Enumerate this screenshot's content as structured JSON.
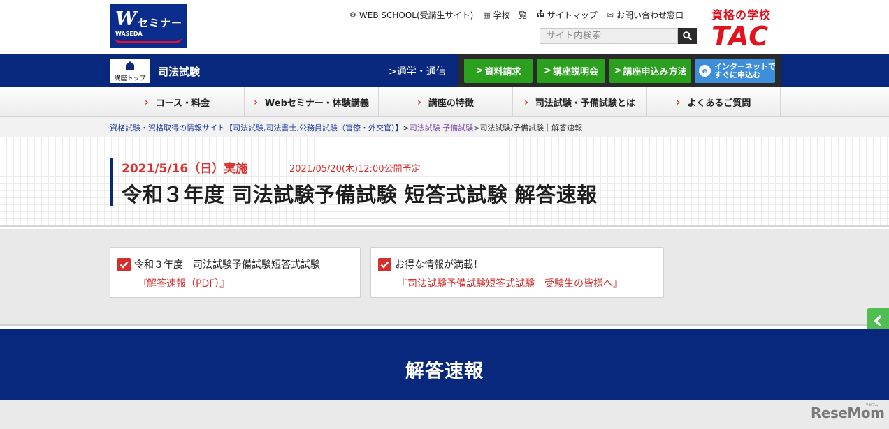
{
  "header": {
    "logo_text": "セミナー",
    "logo_sub": "WASEDA",
    "logo_mark": "W",
    "links": [
      {
        "label": "WEB SCHOOL(受講生サイト)",
        "icon": "gear-icon"
      },
      {
        "label": "学校一覧",
        "icon": "building-icon"
      },
      {
        "label": "サイトマップ",
        "icon": "sitemap-icon"
      },
      {
        "label": "お問い合わせ窓口",
        "icon": "mail-icon"
      }
    ],
    "search_placeholder": "サイト内検索",
    "tac_line1": "資格の学校",
    "tac_line2": "TAC",
    "brand_color": "#e3121d"
  },
  "bluebar": {
    "top_button_label": "講座トップ",
    "title": "司法試験",
    "mode_link": ">通学・通信",
    "cta": [
      {
        "label": "資料請求"
      },
      {
        "label": "講座説明会"
      },
      {
        "label": "講座申込み方法"
      }
    ],
    "net_line1": "インターネットで",
    "net_line2": "すぐに申込む",
    "color": "#08287d"
  },
  "nav": {
    "items": [
      {
        "label": "コース・料金"
      },
      {
        "label": "Webセミナー・体験講義"
      },
      {
        "label": "講座の特徴"
      },
      {
        "label": "司法試験・予備試験とは"
      },
      {
        "label": "よくあるご質問"
      }
    ]
  },
  "breadcrumb": {
    "home": "資格試験・資格取得の情報サイト【司法試験,司法書士,公務員試験（官僚・外交官）】",
    "sep1": ">",
    "section": "司法試験 予備試験",
    "sep2": ">",
    "current": "司法試験/予備試験｜解答速報"
  },
  "hero": {
    "date": "2021/5/16（日）実施",
    "publish": "2021/05/20(木)12:00公開予定",
    "title": "令和３年度 司法試験予備試験 短答式試験 解答速報"
  },
  "cards": [
    {
      "line1": "令和３年度　司法試験予備試験短答式試験",
      "line2": "『解答速報（PDF）』"
    },
    {
      "line1": "お得な情報が満載！",
      "line2": "『司法試験予備試験短答式試験　受験生の皆様へ』"
    }
  ],
  "banner": {
    "title": "解答速報"
  },
  "watermark": {
    "text": "ReseMom",
    "kana": "リセマム"
  }
}
